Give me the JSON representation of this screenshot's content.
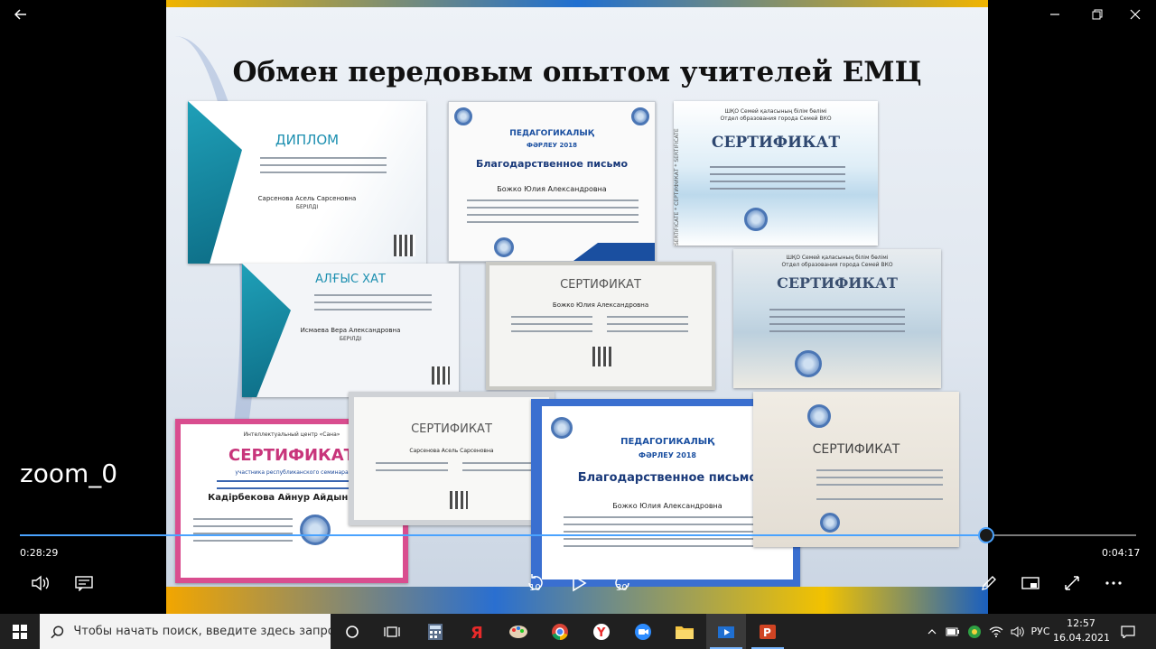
{
  "slide": {
    "title": "Обмен передовым опытом учителей ЕМЦ",
    "certs": {
      "c1": {
        "head": "ДИПЛОМ",
        "name": "Сарсенова Асель Сарсеновна",
        "sub": "БЕРІЛДІ"
      },
      "c2": {
        "head": "Благодарственное письмо",
        "brand": "ПЕДАГОГИКАЛЫҚ",
        "year": "ФӘРЛЕУ 2018",
        "name": "Божко Юлия Александровна"
      },
      "c3": {
        "head": "СЕРТИФИКАТ",
        "top": "ШҚО Семей қаласының білім бөлімі",
        "top2": "Отдел образования города Семей ВКО",
        "side": "SERTIFICATE * СЕРТИФИКАТ * SERTIFICATE"
      },
      "c4": {
        "head": "АЛҒЫС ХАТ",
        "name": "Исмаева Вера Александровна",
        "sub": "БЕРІЛДІ"
      },
      "c5": {
        "head": "СЕРТИФИКАТ",
        "name": "Божко Юлия Александровна"
      },
      "c6": {
        "head": "СЕРТИФИКАТ",
        "top": "ШҚО Семей қаласының білім бөлімі",
        "top2": "Отдел образования города Семей ВКО"
      },
      "c7": {
        "head": "СЕРТИФИКАТ",
        "top": "Интеллектуальный центр «Сана»",
        "sub": "участника республиканского семинара",
        "name": "Кадірбекова Айнур Айдынқызы"
      },
      "c8": {
        "head": "СЕРТИФИКАТ",
        "name": "Сарсенова Асель Сарсеновна"
      },
      "c9": {
        "head": "Благодарственное письмо",
        "brand": "ПЕДАГОГИКАЛЫҚ",
        "year": "ФӘРЛЕУ 2018",
        "name": "Божко Юлия Александровна"
      },
      "c10": {
        "head": "СЕРТИФИКАТ"
      }
    }
  },
  "player": {
    "zoom_label": "zoom_0",
    "elapsed": "0:28:29",
    "remaining": "0:04:17",
    "progress": 0.866,
    "skip_back": "10",
    "skip_forward": "30"
  },
  "taskbar": {
    "search_placeholder": "Чтобы начать поиск, введите здесь запрос",
    "language": "РУС",
    "time": "12:57",
    "date": "16.04.2021"
  },
  "colors": {
    "accent": "#4aa3ff",
    "taskbar": "#202020"
  }
}
